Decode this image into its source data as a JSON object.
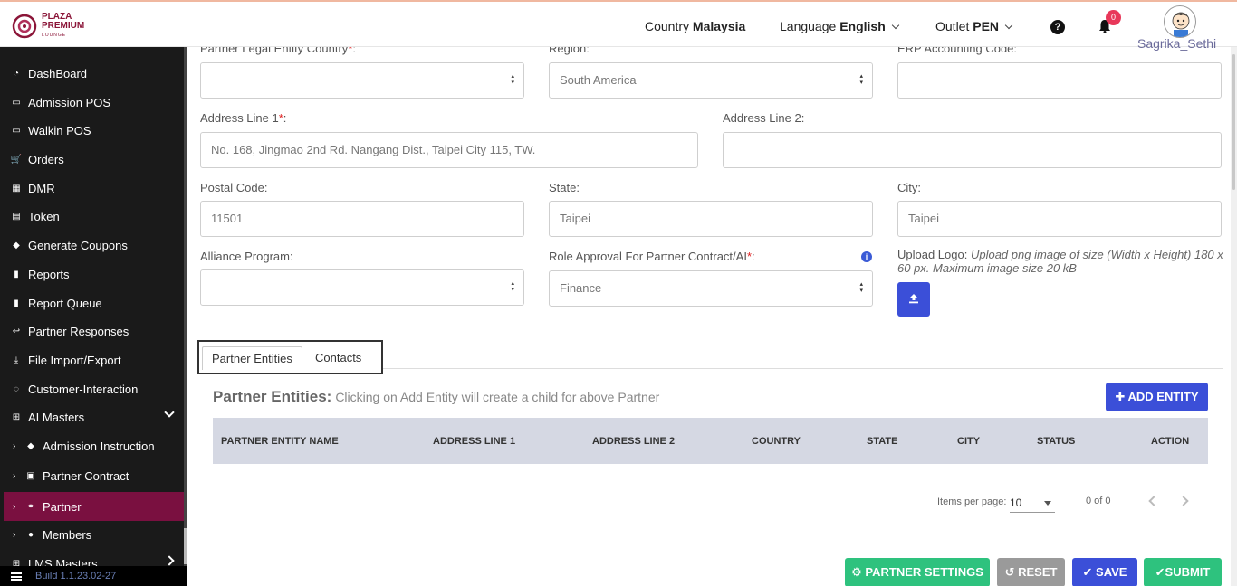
{
  "header": {
    "brand_line1": "PLAZA",
    "brand_line2": "PREMIUM",
    "brand_line3": "LOUNGE",
    "country_label": "Country",
    "country_value": "Malaysia",
    "language_label": "Language",
    "language_value": "English",
    "outlet_label": "Outlet",
    "outlet_value": "PEN",
    "help_glyph": "?",
    "notification_count": "0",
    "username": "Sagrika_Sethi"
  },
  "sidebar": {
    "items": [
      {
        "label": "DashBoard",
        "icon": "dashboard-icon",
        "glyph": "◔"
      },
      {
        "label": "Admission POS",
        "icon": "id-card-icon",
        "glyph": "▭"
      },
      {
        "label": "Walkin POS",
        "icon": "id-card-icon",
        "glyph": "▭"
      },
      {
        "label": "Orders",
        "icon": "cart-icon",
        "glyph": "🛒"
      },
      {
        "label": "DMR",
        "icon": "calendar-icon",
        "glyph": "▦"
      },
      {
        "label": "Token",
        "icon": "file-icon",
        "glyph": "▤"
      },
      {
        "label": "Generate Coupons",
        "icon": "tag-icon",
        "glyph": "◆"
      },
      {
        "label": "Reports",
        "icon": "book-icon",
        "glyph": "▮"
      },
      {
        "label": "Report Queue",
        "icon": "book-icon",
        "glyph": "▮"
      },
      {
        "label": "Partner Responses",
        "icon": "reply-icon",
        "glyph": "↩"
      },
      {
        "label": "File Import/Export",
        "icon": "download-icon",
        "glyph": "⤓"
      },
      {
        "label": "Customer-Interaction",
        "icon": "chat-icon",
        "glyph": "◌"
      },
      {
        "label": "AI Masters",
        "icon": "sitemap-icon",
        "glyph": "⊞"
      },
      {
        "label": "Admission Instruction",
        "icon": "tags-icon",
        "glyph": "◆"
      },
      {
        "label": "Partner Contract",
        "icon": "briefcase-icon",
        "glyph": "▣"
      },
      {
        "label": "Partner",
        "icon": "handshake-icon",
        "glyph": "⚭"
      },
      {
        "label": "Members",
        "icon": "users-icon",
        "glyph": "●"
      },
      {
        "label": "LMS Masters",
        "icon": "sitemap-icon",
        "glyph": "⊞"
      }
    ],
    "build": "Build 1.1.23.02-27"
  },
  "form": {
    "legal_country_label": "Partner Legal Entity Country",
    "legal_country_value": "",
    "region_label": "Region:",
    "region_value": "South America",
    "erp_label": "ERP Accounting Code:",
    "erp_value": "",
    "address1_label": "Address Line 1",
    "address1_value": "No. 168, Jingmao 2nd Rd. Nangang Dist., Taipei City 115, TW.",
    "address2_label": "Address Line 2:",
    "address2_value": "",
    "postal_label": "Postal Code:",
    "postal_value": "11501",
    "state_label": "State:",
    "state_value": "Taipei",
    "city_label": "City:",
    "city_value": "Taipei",
    "alliance_label": "Alliance Program:",
    "alliance_value": "",
    "role_label": "Role Approval For Partner Contract/AI",
    "role_value": "Finance",
    "upload_label": "Upload Logo:",
    "upload_hint": "Upload png image of size (Width x Height) 180 x 60 px. Maximum image size 20 kB",
    "required_mark": "*",
    "colon": ":"
  },
  "tabs": [
    {
      "label": "Partner Entities"
    },
    {
      "label": "Contacts"
    }
  ],
  "entities": {
    "title": "Partner Entities:",
    "subtitle": "Clicking on Add Entity will create a child for above Partner",
    "add_button": "ADD ENTITY",
    "columns": [
      "PARTNER ENTITY NAME",
      "ADDRESS LINE 1",
      "ADDRESS LINE 2",
      "COUNTRY",
      "STATE",
      "CITY",
      "STATUS",
      "ACTION"
    ],
    "items_per_page_label": "Items per page:",
    "items_per_page_value": "10",
    "range_label": "0 of 0"
  },
  "actions": {
    "partner_settings": "PARTNER SETTINGS",
    "reset": "RESET",
    "save": "SAVE",
    "submit": "SUBMIT"
  },
  "colors": {
    "brand": "#8b1538",
    "sidebar_active": "#7a1040",
    "primary": "#3b4fd8",
    "success": "#2ec27e",
    "table_header": "#d5d8e3"
  }
}
